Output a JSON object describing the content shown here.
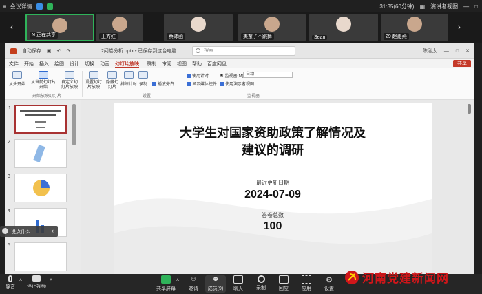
{
  "top": {
    "title": "会议详情",
    "time": "31:35(60分钟)",
    "presenter_view": "演讲者视图"
  },
  "participants": [
    {
      "name": "N.正在共享",
      "muted": false
    },
    {
      "name": "王秀红",
      "muted": false
    },
    {
      "name": "蔡沛函",
      "muted": true
    },
    {
      "name": "美奈子不跳舞",
      "muted": true
    },
    {
      "name": "Sean",
      "muted": true
    },
    {
      "name": "29 赵惠燕",
      "muted": true
    }
  ],
  "ppt": {
    "autosave": "自动保存",
    "filename": "2问卷分析.pptx • 已保存到这台电脑",
    "search_placeholder": "搜索",
    "user": "陈泓太",
    "menus": [
      "文件",
      "开始",
      "插入",
      "绘图",
      "设计",
      "切换",
      "动画",
      "幻灯片放映",
      "录制",
      "审阅",
      "视图",
      "帮助",
      "百度网盘"
    ],
    "active_menu": "幻灯片放映",
    "share": "共享",
    "ribbon": {
      "from_begin": "从头开始",
      "from_current": "从当前幻灯片开始",
      "custom": "自定义幻灯片放映",
      "setup": "设置幻灯片放映",
      "hide": "隐藏幻灯片",
      "rehearse": "排练计时",
      "record": "录制",
      "narration": "播放旁白",
      "use_timing": "使用计时",
      "show_media": "显示媒体控件",
      "monitor_label": "监视器(M):",
      "monitor_value": "自动",
      "presenter": "使用演示者视图",
      "group1": "开始放映幻灯片",
      "group2": "设置",
      "group3": "监视器"
    },
    "thumb_numbers": [
      "1",
      "2",
      "3",
      "4",
      "5"
    ],
    "slide": {
      "title_line1": "大学生对国家资助政策了解情况及",
      "title_line2": "建议的调研",
      "updated_label": "最近更新日期",
      "updated_value": "2024-07-09",
      "total_label": "答卷总数",
      "total_value": "100"
    }
  },
  "popup": "说点什么...",
  "toolbar": {
    "mute": "静音",
    "video": "停止视频",
    "share_screen": "共享屏幕",
    "invite": "邀请",
    "members": "成员(9)",
    "chat": "聊天",
    "record": "录制",
    "apps": "应用",
    "settings": "设置",
    "react": "回应"
  },
  "watermark": "河南党建新闻网",
  "colors": {
    "brand_red": "#d0161a",
    "accent": "#c0392b",
    "share_green": "#2fb35a"
  }
}
